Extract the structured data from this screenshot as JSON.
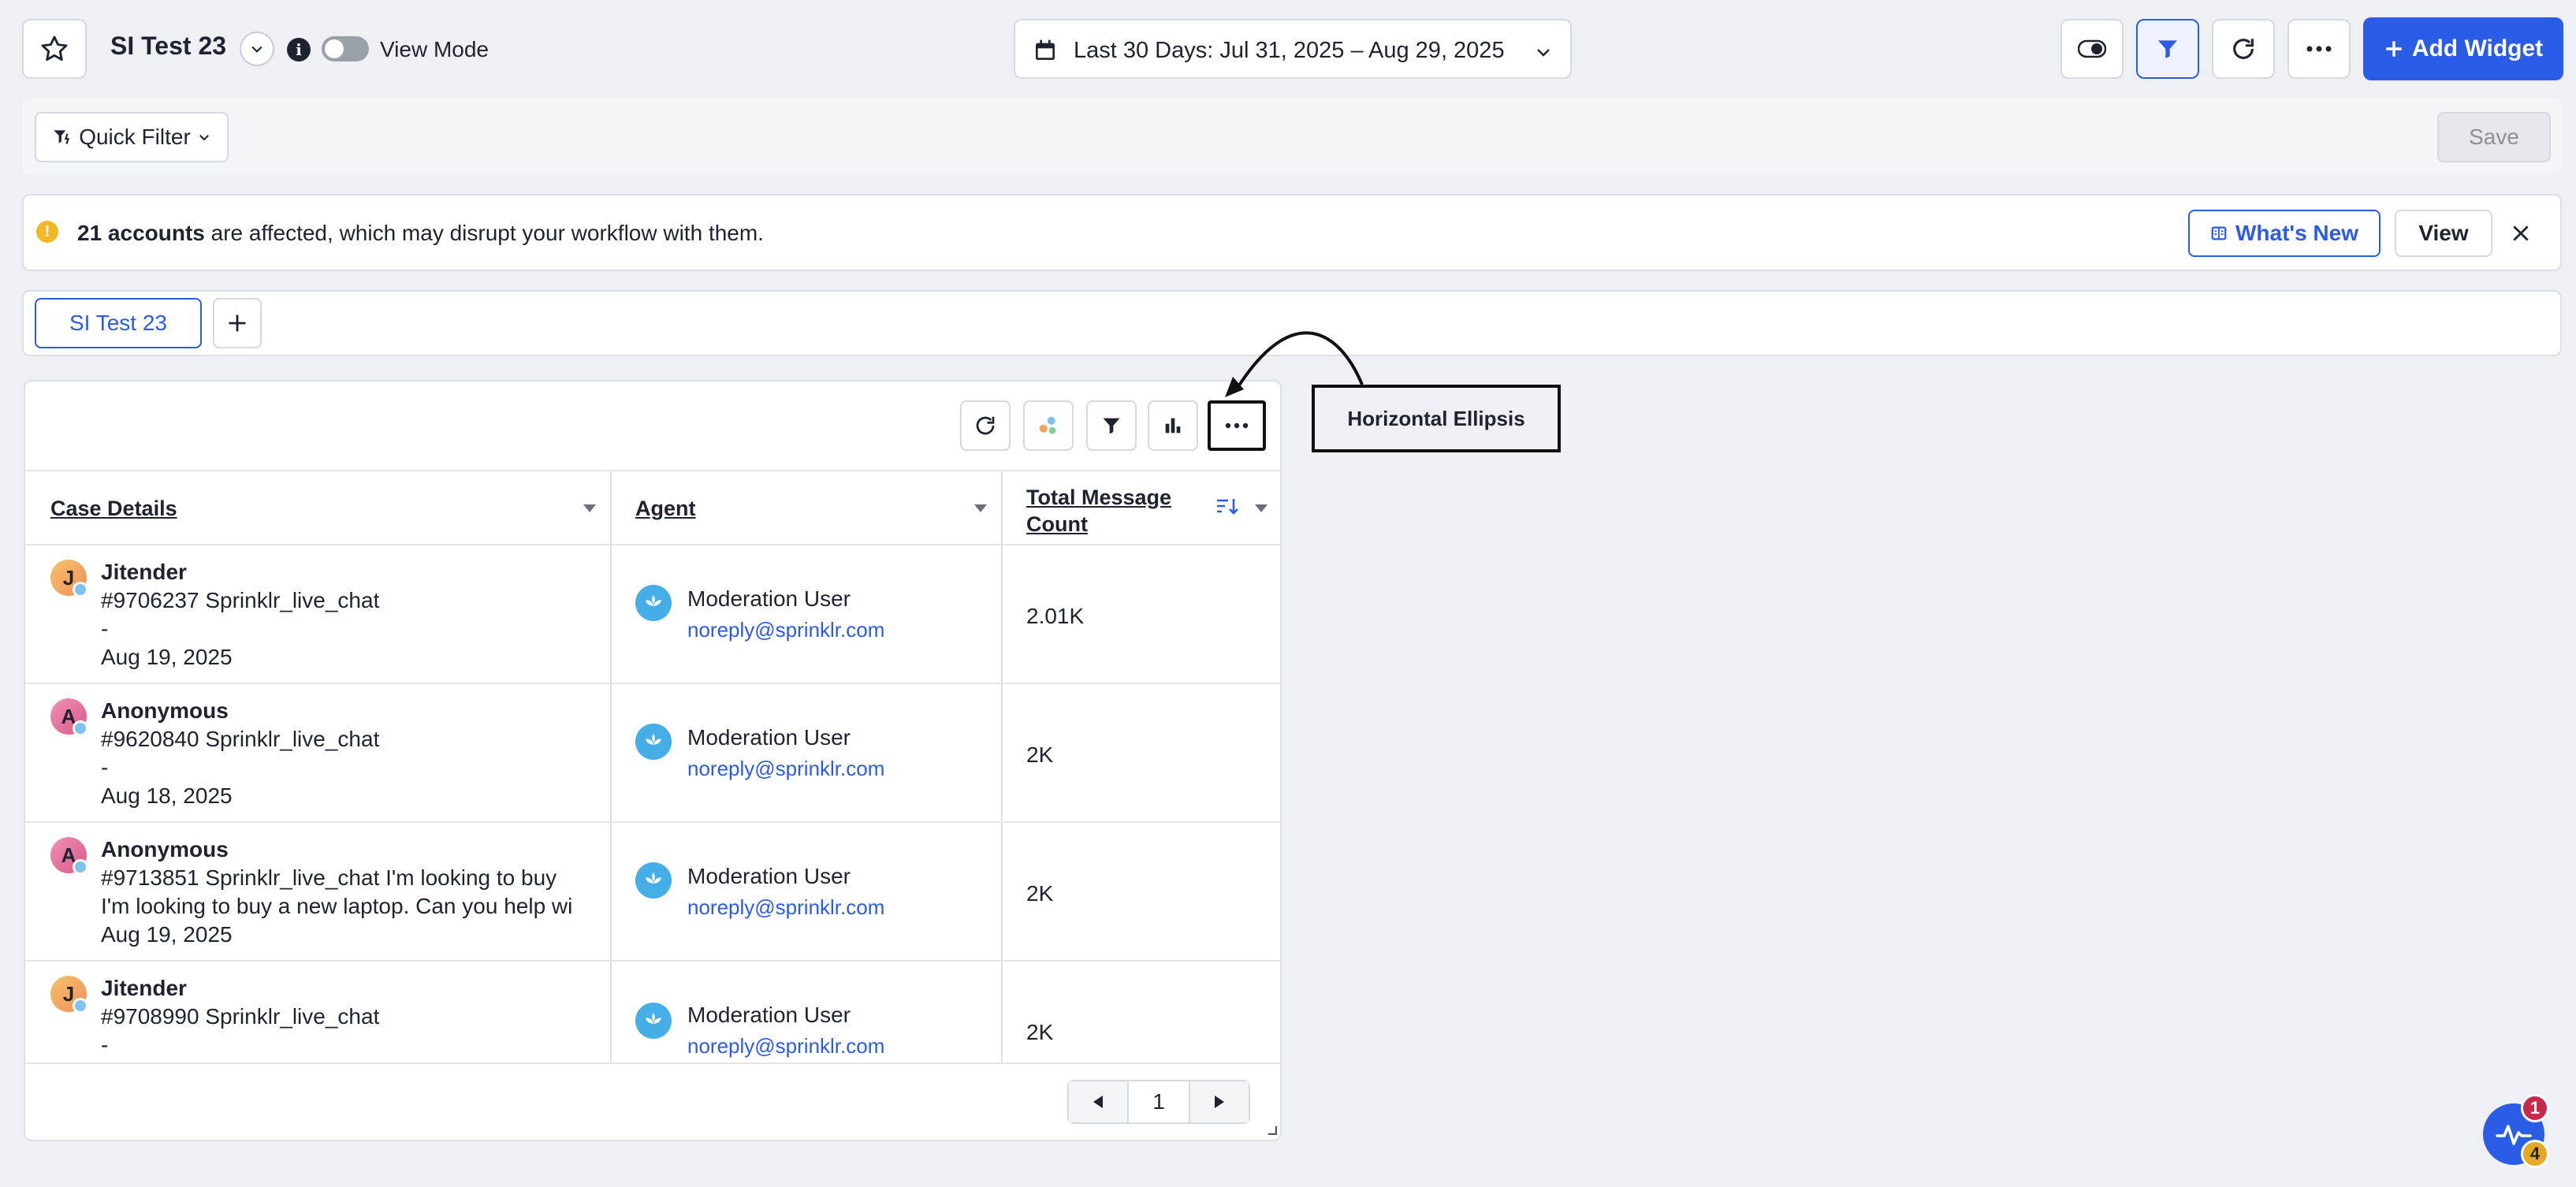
{
  "header": {
    "title": "SI Test 23",
    "view_mode_label": "View Mode",
    "date_range": "Last 30 Days: Jul 31, 2025 – Aug 29, 2025",
    "add_widget_label": "Add Widget"
  },
  "filter_bar": {
    "quick_filter_label": "Quick Filter",
    "save_label": "Save"
  },
  "alert": {
    "bold_text": "21 accounts",
    "text": " are affected, which may disrupt your workflow with them.",
    "whats_new_label": "What's New",
    "view_label": "View"
  },
  "tabs": [
    {
      "label": "SI Test 23",
      "active": true
    }
  ],
  "table": {
    "columns": [
      "Case Details",
      "Agent",
      "Total Message Count"
    ],
    "rows": [
      {
        "avatar_letter": "J",
        "name": "Jitender",
        "case_line": "#9706237 Sprinklr_live_chat",
        "extra_line": "-",
        "date": "Aug 19, 2025",
        "agent_name": "Moderation User",
        "agent_email": "noreply@sprinklr.com",
        "count": "2.01K"
      },
      {
        "avatar_letter": "A",
        "name": "Anonymous",
        "case_line": "#9620840 Sprinklr_live_chat",
        "extra_line": "-",
        "date": "Aug 18, 2025",
        "agent_name": "Moderation User",
        "agent_email": "noreply@sprinklr.com",
        "count": "2K"
      },
      {
        "avatar_letter": "A",
        "name": "Anonymous",
        "case_line": "#9713851 Sprinklr_live_chat I'm looking to buy",
        "extra_line": "I'm looking to buy a new laptop. Can you help wi",
        "date": "Aug 19, 2025",
        "agent_name": "Moderation User",
        "agent_email": "noreply@sprinklr.com",
        "count": "2K"
      },
      {
        "avatar_letter": "J",
        "name": "Jitender",
        "case_line": "#9708990 Sprinklr_live_chat",
        "extra_line": "-",
        "date": "",
        "agent_name": "Moderation User",
        "agent_email": "noreply@sprinklr.com",
        "count": "2K"
      }
    ]
  },
  "pagination": {
    "page": "1"
  },
  "annotation": {
    "label": "Horizontal Ellipsis"
  },
  "notifications": {
    "red_count": "1",
    "yellow_count": "4"
  },
  "colors": {
    "accent": "#2b5ce6",
    "warning": "#f2b825",
    "background": "#eef0f3"
  }
}
